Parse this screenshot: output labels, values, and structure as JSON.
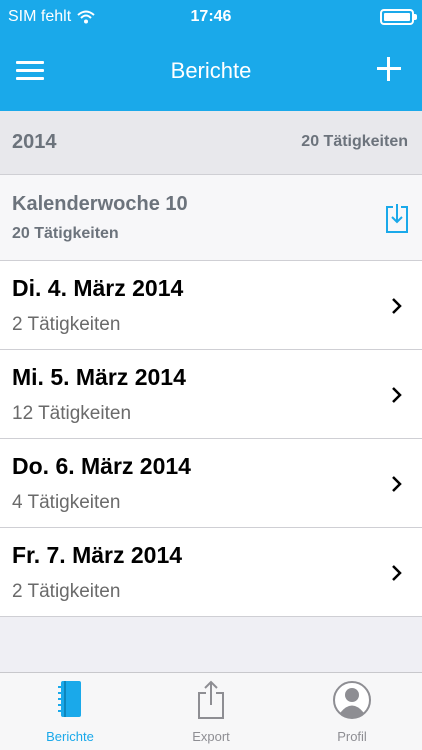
{
  "status": {
    "carrier": "SIM fehlt",
    "time": "17:46"
  },
  "nav": {
    "title": "Berichte"
  },
  "section": {
    "year": "2014",
    "count": "20 Tätigkeiten"
  },
  "week": {
    "title": "Kalenderwoche 10",
    "count": "20 Tätigkeiten"
  },
  "days": [
    {
      "title": "Di. 4. März 2014",
      "count": "2 Tätigkeiten"
    },
    {
      "title": "Mi. 5. März 2014",
      "count": "12 Tätigkeiten"
    },
    {
      "title": "Do. 6. März 2014",
      "count": "4 Tätigkeiten"
    },
    {
      "title": "Fr. 7. März 2014",
      "count": "2 Tätigkeiten"
    }
  ],
  "tabs": [
    {
      "label": "Berichte",
      "icon": "notebook-icon",
      "active": true
    },
    {
      "label": "Export",
      "icon": "share-icon",
      "active": false
    },
    {
      "label": "Profil",
      "icon": "person-icon",
      "active": false
    }
  ],
  "colors": {
    "accent": "#1aa9ea",
    "inactive": "#8e8e93"
  }
}
